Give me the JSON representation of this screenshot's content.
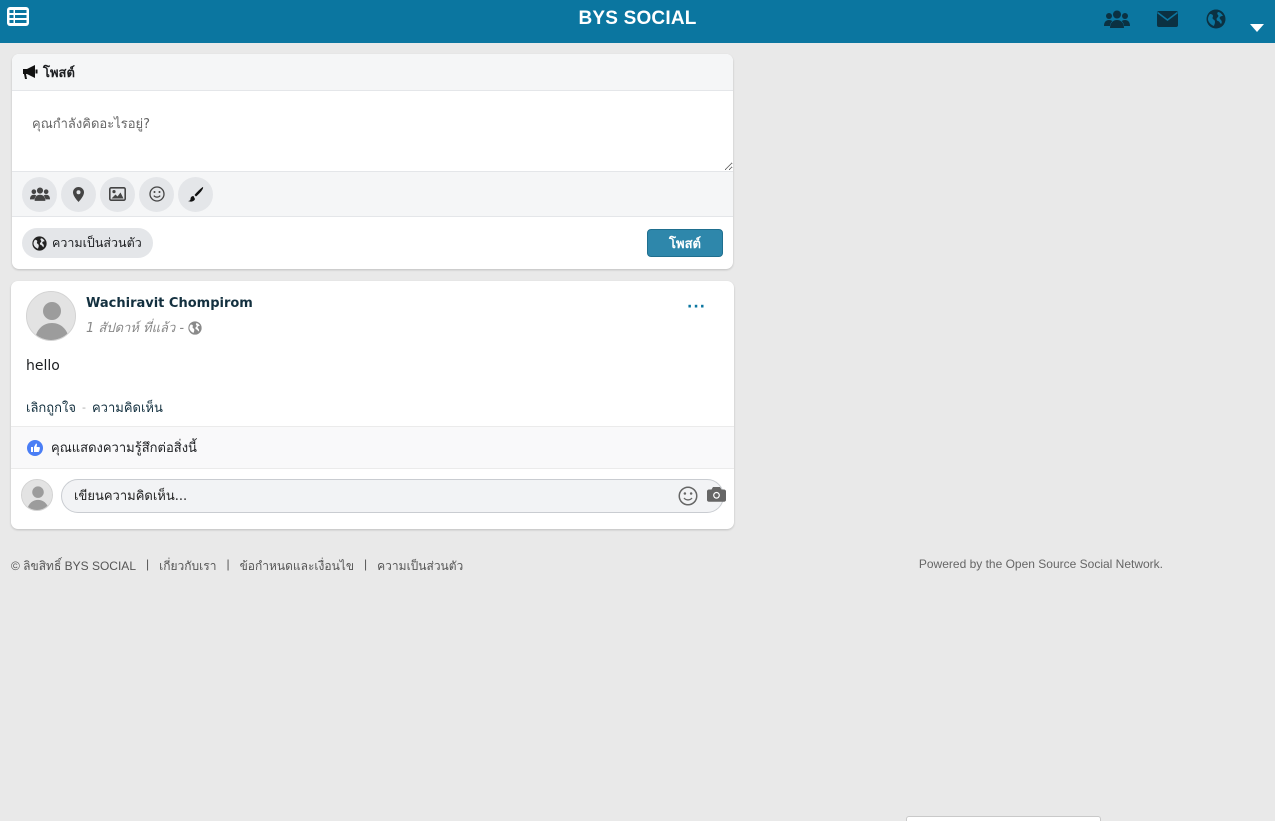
{
  "colors": {
    "topbar": "#0b76a0",
    "accent": "#2e87ab",
    "like": "#4a7ef5"
  },
  "topbar": {
    "title": "BYS SOCIAL",
    "icons": [
      "menu-list-icon",
      "friends-icon",
      "messages-icon",
      "notifications-globe-icon",
      "caret-down-icon"
    ]
  },
  "composer": {
    "header": "โพสต์",
    "placeholder": "คุณกำลังคิดอะไรอยู่?",
    "tools": [
      "tag-friends-icon",
      "location-pin-icon",
      "photo-icon",
      "emoji-icon",
      "brush-icon"
    ],
    "privacy_label": "ความเป็นส่วนตัว",
    "post_label": "โพสต์"
  },
  "post": {
    "author": "Wachiravit Chompirom",
    "time": "1 สัปดาห์ ที่แล้ว -",
    "text": "hello",
    "unlike_label": "เลิกถูกใจ",
    "separator": "-",
    "comment_label": "ความคิดเห็น",
    "reaction_text": "คุณแสดงความรู้สึกต่อสิ่งนี้",
    "comment_placeholder": "เขียนความคิดเห็น...",
    "more_label": "···"
  },
  "footer": {
    "copyright": "© ลิขสิทธิ์ BYS SOCIAL",
    "about": "เกี่ยวกับเรา",
    "terms": "ข้อกำหนดและเงื่อนไข",
    "privacy": "ความเป็นส่วนตัว",
    "divider": "|",
    "powered": "Powered by the Open Source Social Network."
  }
}
